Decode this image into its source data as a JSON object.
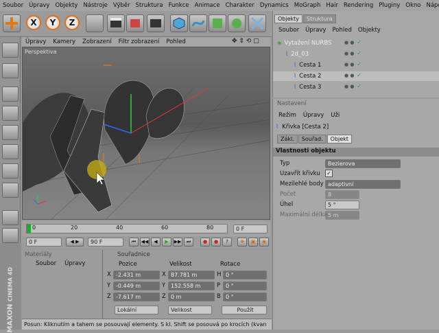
{
  "menu": [
    "Soubor",
    "Úpravy",
    "Objekty",
    "Nástroje",
    "Výběr",
    "Struktura",
    "Funkce",
    "Animace",
    "Charakter",
    "Dynamics",
    "MoGraph",
    "Hair",
    "Rendering",
    "Pluginy",
    "Okno",
    "Nápověda"
  ],
  "axes": {
    "x": "X",
    "y": "Y",
    "z": "Z"
  },
  "viewport": {
    "menu": [
      "Úpravy",
      "Kamery",
      "Zobrazení",
      "Filtr zobrazení",
      "Pohled"
    ],
    "label": "Perspektiva"
  },
  "timeline": {
    "ticks": [
      "0",
      "20",
      "40",
      "60",
      "80"
    ],
    "current_frame": "0 F"
  },
  "transport": {
    "start": "0 F",
    "end": "90 F"
  },
  "materials": {
    "title": "Materiály",
    "menu": [
      "Soubor",
      "Úpravy"
    ]
  },
  "coords": {
    "title": "Souřadnice",
    "headers": [
      "Pozice",
      "Velikost",
      "Rotace"
    ],
    "rows": [
      {
        "axis": "X",
        "pos": "-2.431 m",
        "saxis": "X",
        "size": "87.781 m",
        "raxis": "H",
        "rot": "0 °"
      },
      {
        "axis": "Y",
        "pos": "-0.449 m",
        "saxis": "Y",
        "size": "152.558 m",
        "raxis": "P",
        "rot": "0 °"
      },
      {
        "axis": "Z",
        "pos": "-7.617 m",
        "saxis": "Z",
        "size": "0 m",
        "raxis": "B",
        "rot": "0 °"
      }
    ],
    "mode1": "Lokální",
    "mode2": "Velikost",
    "apply": "Použít"
  },
  "status": "Posun: Kliknutím a tahem se posouvají elementy. S kl. Shift se posouvá po krocích (kvan",
  "logo": {
    "brand": "MAXON",
    "product": "CINEMA 4D"
  },
  "objects": {
    "tabs": [
      "Objekty",
      "Struktura"
    ],
    "menu": [
      "Soubor",
      "Úpravy",
      "Pohled",
      "Objekty"
    ],
    "items": [
      {
        "name": "Vytažení NURBS",
        "level": 0
      },
      {
        "name": "2d_03",
        "level": 1
      },
      {
        "name": "Cesta 1",
        "level": 2
      },
      {
        "name": "Cesta 2",
        "level": 2
      },
      {
        "name": "Cesta 3",
        "level": 2
      }
    ]
  },
  "attributes": {
    "title": "Nastavení",
    "menu": [
      "Režim",
      "Úpravy",
      "Uži"
    ],
    "object_name": "Křivka [Cesta 2]",
    "tabs": [
      "Zákl.",
      "Souřad.",
      "Objekt"
    ],
    "section": "Vlastnosti objektu",
    "fields": [
      {
        "label": "Typ",
        "value": "Bezierova"
      },
      {
        "label": "Uzavřít křivku",
        "value": "✓"
      },
      {
        "label": "Mezilehlé body",
        "value": "adaptivní"
      },
      {
        "label": "Počet",
        "value": "8"
      },
      {
        "label": "Úhel",
        "value": "5 °"
      },
      {
        "label": "Maximální délka",
        "value": "5 m"
      }
    ]
  }
}
